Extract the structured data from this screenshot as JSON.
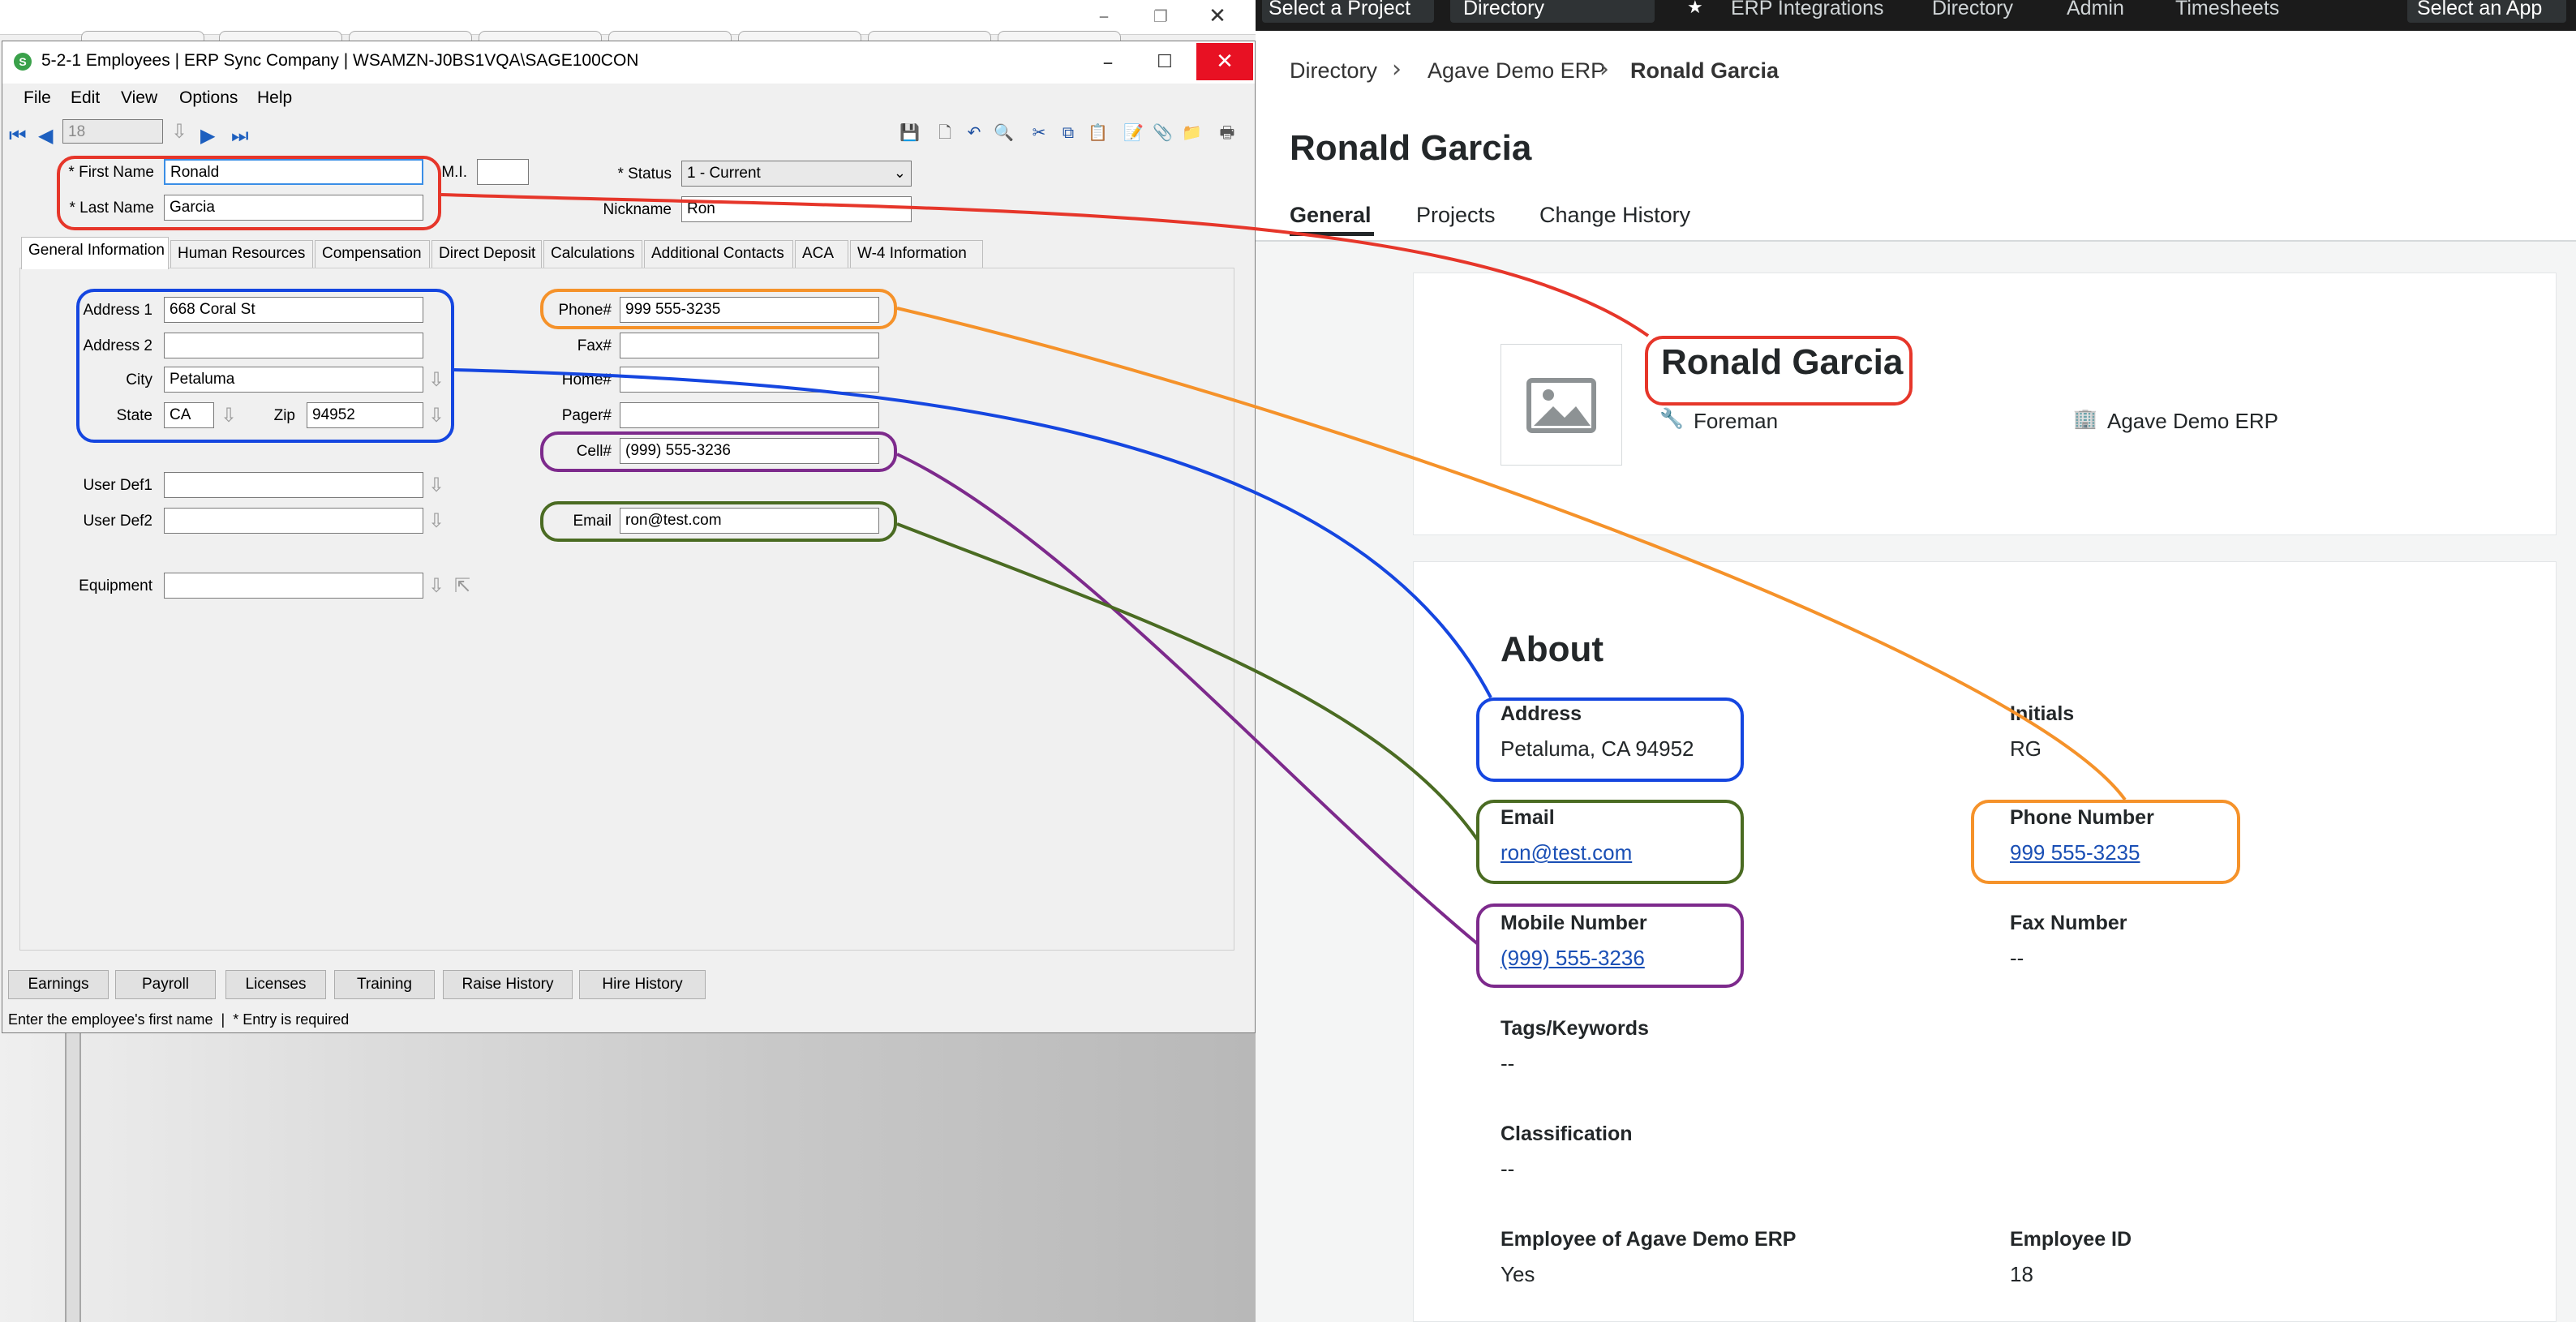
{
  "colors": {
    "red": "#e6362a",
    "blue": "#1546e0",
    "orange": "#f5922a",
    "purple": "#7d2a8c",
    "green": "#4a6b22",
    "link": "#1a4fb5",
    "topnav_bg": "#1b1b1b"
  },
  "sage": {
    "window_title": "5-2-1 Employees | ERP Sync Company | WSAMZN-J0BS1VQA\\SAGE100CON",
    "menu": [
      "File",
      "Edit",
      "View",
      "Options",
      "Help"
    ],
    "record_number": "18",
    "labels": {
      "first_name": "* First Name",
      "last_name": "* Last Name",
      "mi": "M.I.",
      "status": "* Status",
      "nickname": "Nickname",
      "address1": "Address 1",
      "address2": "Address 2",
      "city": "City",
      "state": "State",
      "zip": "Zip",
      "user_def1": "User Def1",
      "user_def2": "User Def2",
      "equipment": "Equipment",
      "phone": "Phone#",
      "fax": "Fax#",
      "home": "Home#",
      "pager": "Pager#",
      "cell": "Cell#",
      "email": "Email"
    },
    "values": {
      "first_name": "Ronald",
      "last_name": "Garcia",
      "mi": "",
      "status": "1 - Current",
      "nickname": "Ron",
      "address1": "668 Coral St",
      "address2": "",
      "city": "Petaluma",
      "state": "CA",
      "zip": "94952",
      "user_def1": "",
      "user_def2": "",
      "equipment": "",
      "phone": "999 555-3235",
      "fax": "",
      "home": "",
      "pager": "",
      "cell": "(999) 555-3236",
      "email": "ron@test.com"
    },
    "tabs": [
      "General Information",
      "Human Resources",
      "Compensation",
      "Direct Deposit",
      "Calculations",
      "Additional Contacts",
      "ACA",
      "W-4 Information"
    ],
    "bottom_buttons": [
      "Earnings",
      "Payroll",
      "Licenses",
      "Training",
      "Raise History",
      "Hire History"
    ],
    "status_bar": "Enter the employee's first name  |  * Entry is required"
  },
  "web": {
    "topnav": {
      "project_select": "Select a Project",
      "directory_select": "Directory",
      "items": [
        "ERP Integrations",
        "Directory",
        "Admin",
        "Timesheets"
      ],
      "app_select": "Select an App"
    },
    "breadcrumb": [
      "Directory",
      "Agave Demo ERP",
      "Ronald Garcia"
    ],
    "page_title": "Ronald Garcia",
    "tabs": [
      "General",
      "Projects",
      "Change History"
    ],
    "profile": {
      "name": "Ronald Garcia",
      "role": "Foreman",
      "company": "Agave Demo ERP"
    },
    "about": {
      "heading": "About",
      "address_label": "Address",
      "address_value": "Petaluma, CA 94952",
      "initials_label": "Initials",
      "initials_value": "RG",
      "email_label": "Email",
      "email_value": "ron@test.com",
      "phone_label": "Phone Number",
      "phone_value": "999 555-3235",
      "mobile_label": "Mobile Number",
      "mobile_value": "(999) 555-3236",
      "fax_label": "Fax Number",
      "fax_value": "--",
      "tags_label": "Tags/Keywords",
      "tags_value": "--",
      "classification_label": "Classification",
      "classification_value": "--",
      "employee_of_label": "Employee of Agave Demo ERP",
      "employee_of_value": "Yes",
      "employee_id_label": "Employee ID",
      "employee_id_value": "18"
    }
  }
}
